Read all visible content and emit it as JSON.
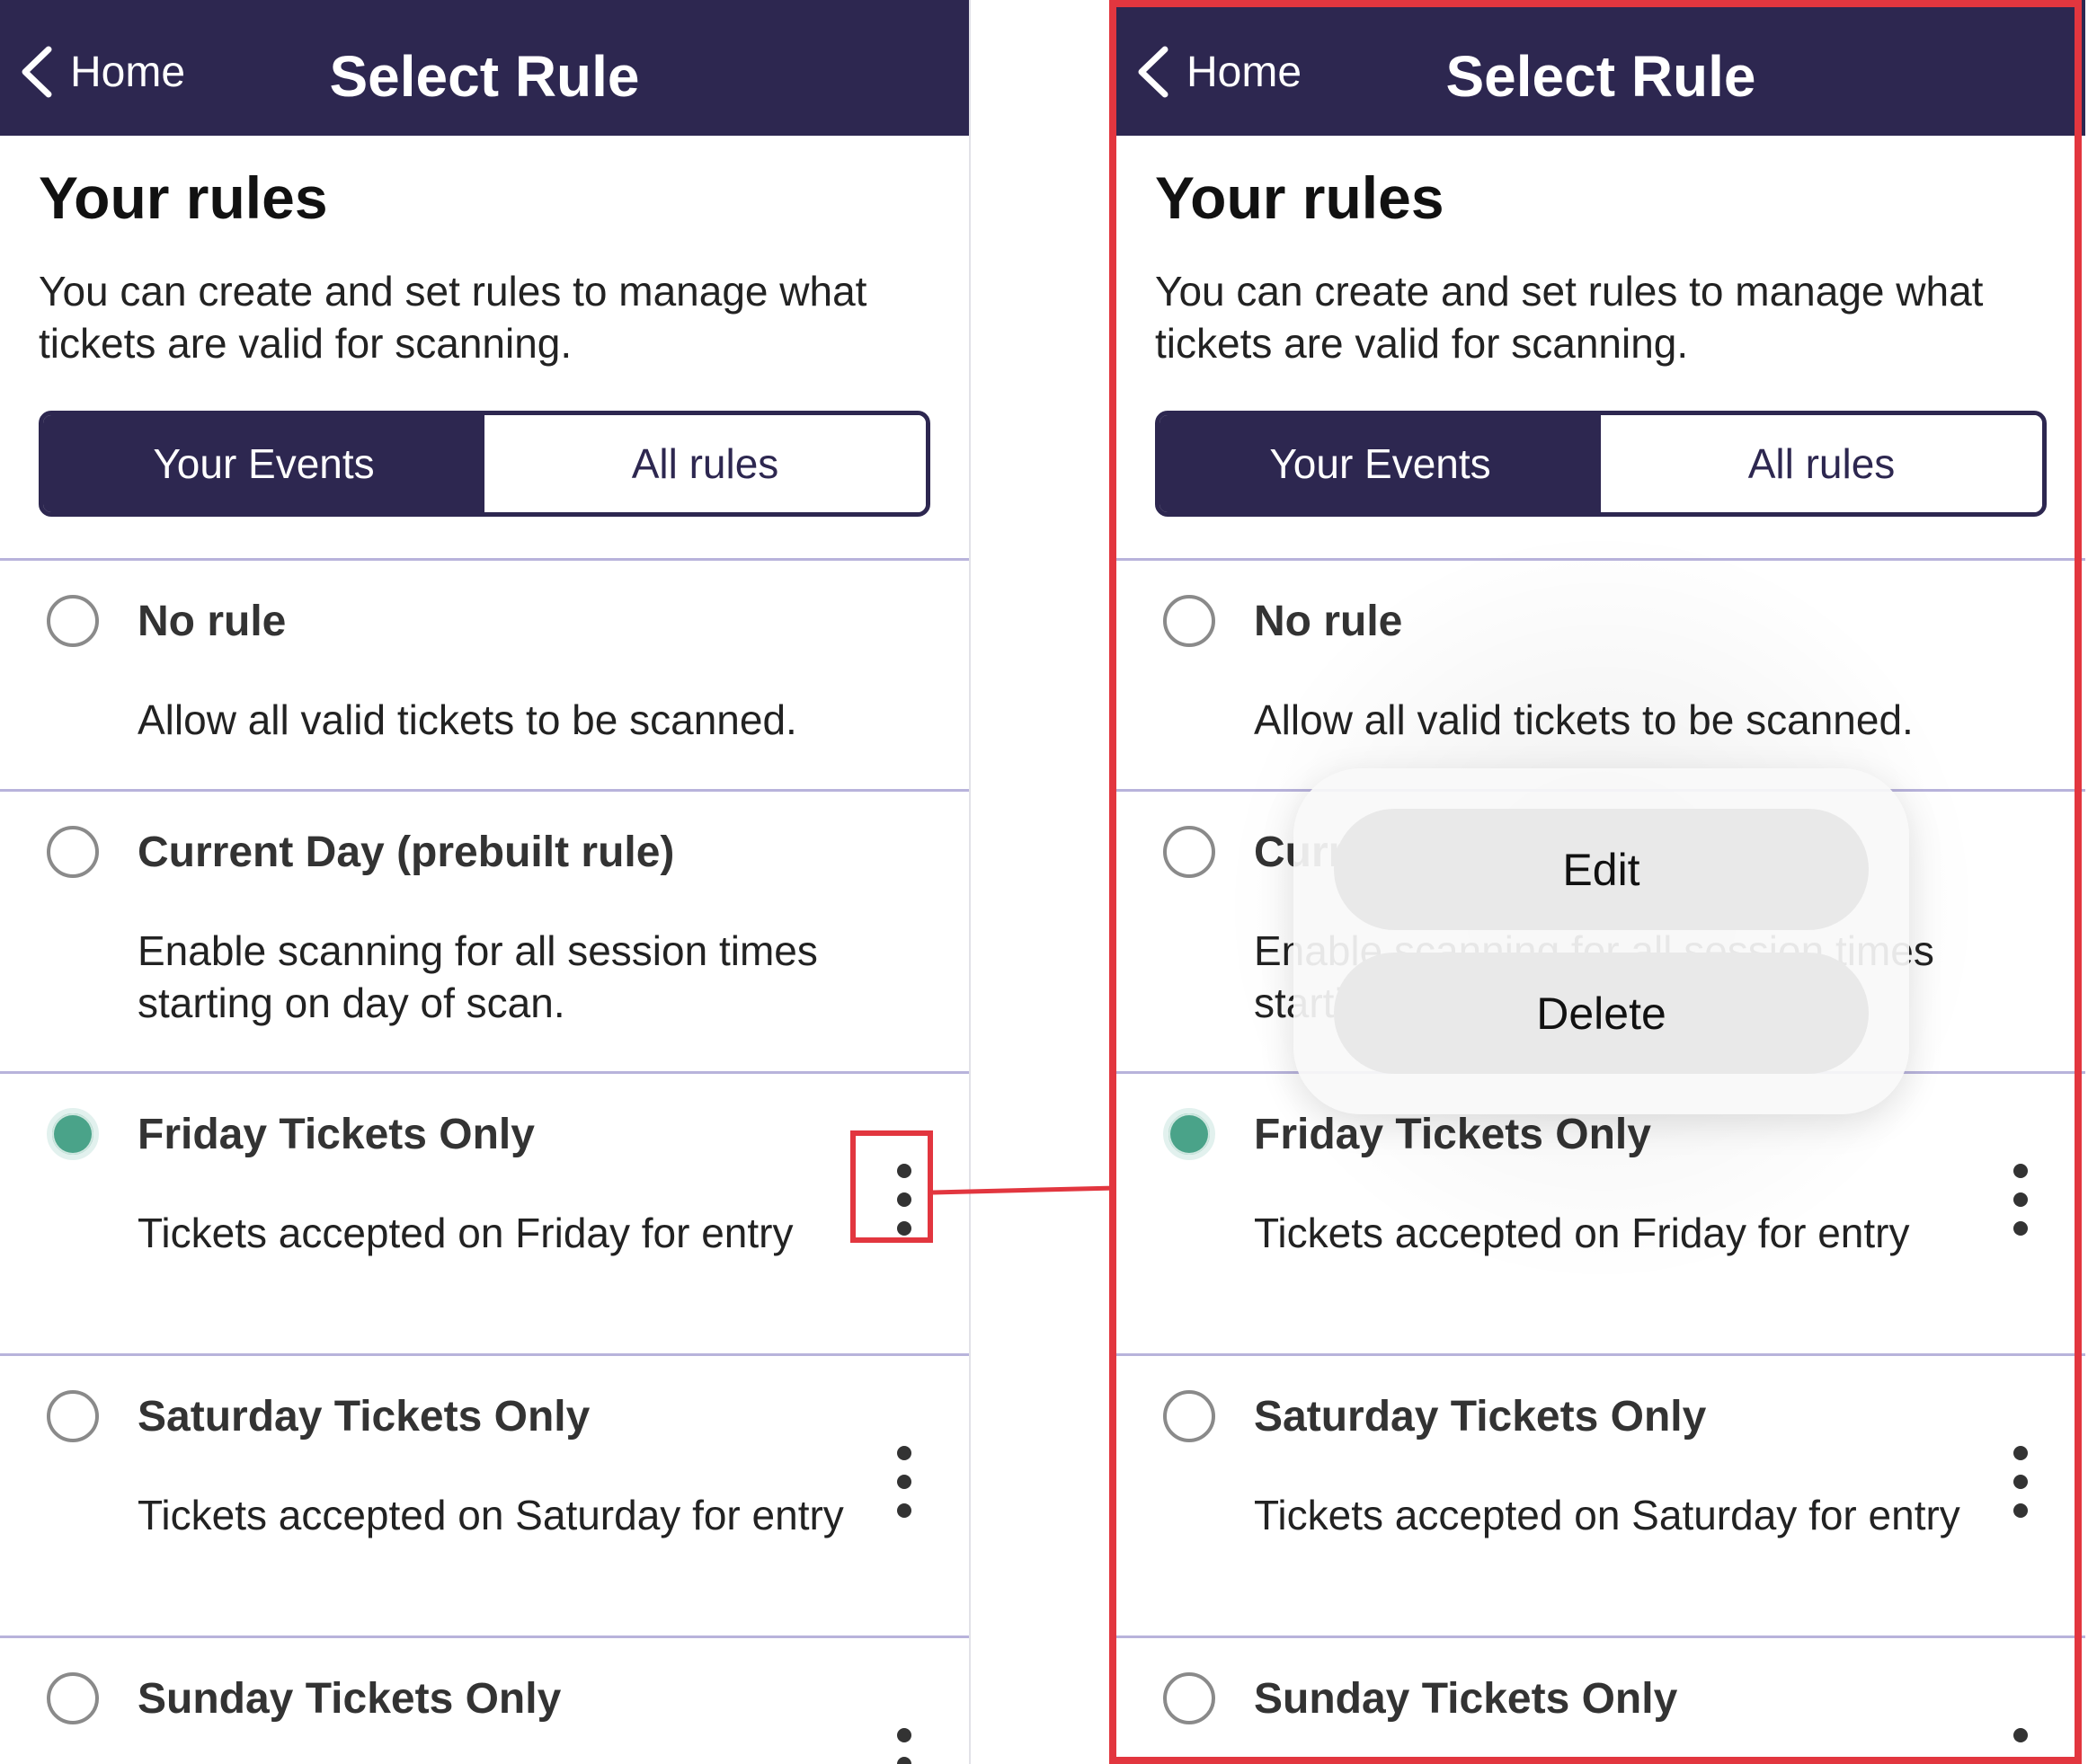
{
  "nav": {
    "back_label": "Home",
    "title": "Select Rule"
  },
  "heading": "Your rules",
  "description": "You can create and set rules to manage what tickets are valid for scanning.",
  "tabs": [
    {
      "label": "Your Events",
      "active": true
    },
    {
      "label": "All rules",
      "active": false
    }
  ],
  "rules": [
    {
      "title": "No rule",
      "description": "Allow all valid tickets to be scanned.",
      "selected": false
    },
    {
      "title": "Current Day (prebuilt rule)",
      "description": "Enable scanning for all session times starting on day of scan.",
      "selected": false
    },
    {
      "title": "Friday Tickets Only",
      "description": "Tickets accepted on Friday for entry",
      "selected": true
    },
    {
      "title": "Saturday Tickets Only",
      "description": "Tickets accepted on Saturday for entry",
      "selected": false
    },
    {
      "title": "Sunday Tickets Only",
      "description": "",
      "selected": false
    }
  ],
  "context_menu": {
    "edit_label": "Edit",
    "delete_label": "Delete"
  },
  "colors": {
    "navbar": "#2d2750",
    "selected_radio": "#4aa389",
    "highlight": "#e2363f",
    "divider": "#b8b3db"
  },
  "icons": {
    "back": "chevron-left-icon",
    "more": "more-vertical-icon"
  }
}
